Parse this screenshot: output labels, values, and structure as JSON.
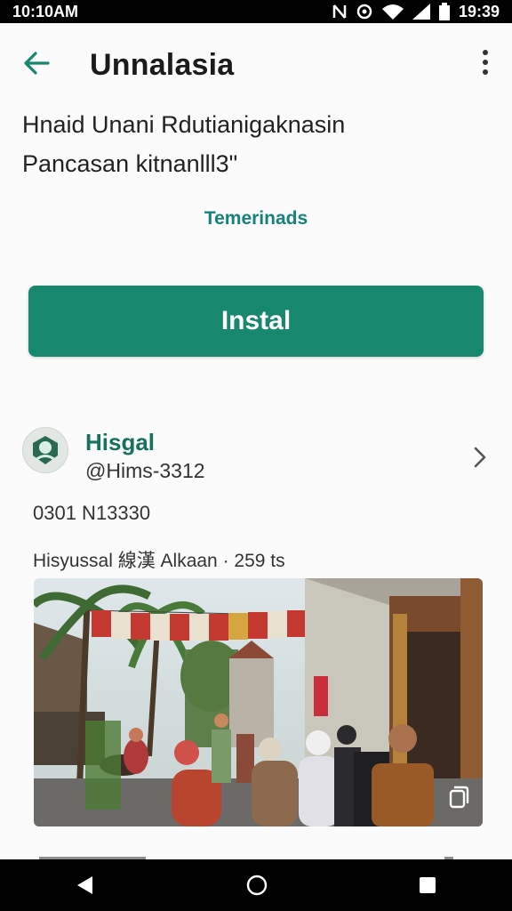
{
  "status": {
    "time": "10:10AM",
    "clock_right": "19:39"
  },
  "header": {
    "title": "Unnalasia"
  },
  "subtitle": {
    "line1": "Hnaid Unani Rdutianigaknasin",
    "line2": "Pancasan kitnanlll3\""
  },
  "center_link": "Temerinads",
  "install_label": "Instal",
  "profile": {
    "name": "Hisgal",
    "handle": "@Hims-3312"
  },
  "meta": {
    "line1": "0301 N13330",
    "line2": "Hisyussal 線漢 Alkaan · 259 ts"
  },
  "colors": {
    "accent": "#17876e",
    "link": "#16837a",
    "name": "#16725e"
  },
  "icons": {
    "back": "arrow-left-icon",
    "more": "more-vert-icon",
    "chevron": "chevron-right-icon",
    "copy": "copy-icon",
    "nav_back": "nav-back-icon",
    "nav_home": "nav-home-icon",
    "nav_recent": "nav-recent-icon"
  }
}
